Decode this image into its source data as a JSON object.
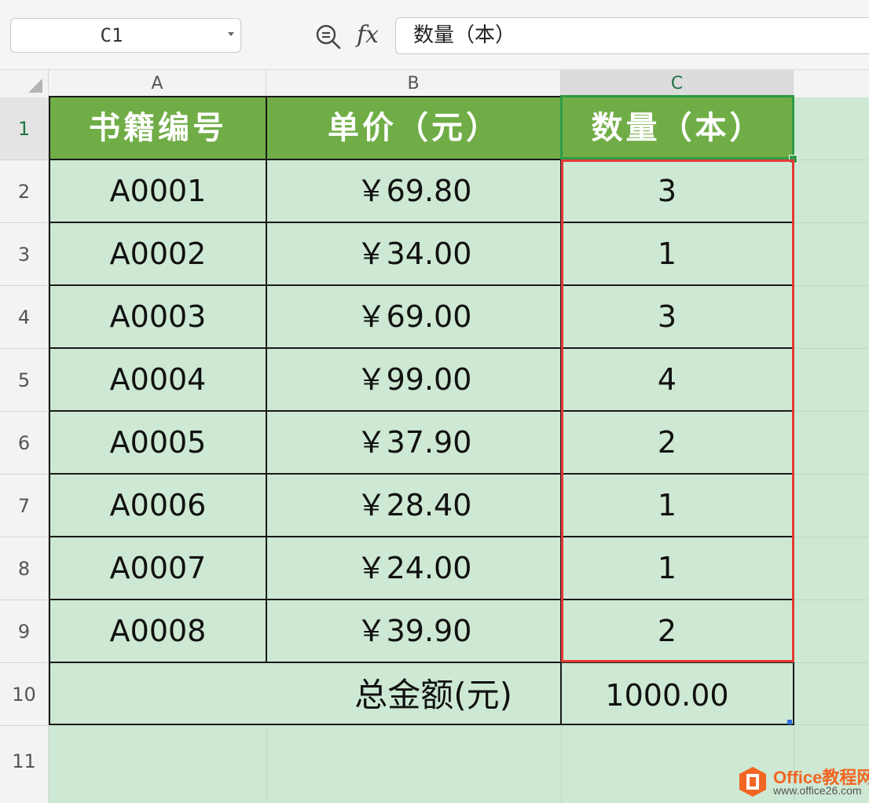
{
  "formula_bar": {
    "name_box": "C1",
    "formula": "数量（本）"
  },
  "columns": [
    "A",
    "B",
    "C"
  ],
  "rows": [
    "1",
    "2",
    "3",
    "4",
    "5",
    "6",
    "7",
    "8",
    "9",
    "10",
    "11"
  ],
  "table": {
    "headers": [
      "书籍编号",
      "单价（元）",
      "数量（本）"
    ],
    "records": [
      {
        "id": "A0001",
        "price": "￥69.80",
        "qty": "3"
      },
      {
        "id": "A0002",
        "price": "￥34.00",
        "qty": "1"
      },
      {
        "id": "A0003",
        "price": "￥69.00",
        "qty": "3"
      },
      {
        "id": "A0004",
        "price": "￥99.00",
        "qty": "4"
      },
      {
        "id": "A0005",
        "price": "￥37.90",
        "qty": "2"
      },
      {
        "id": "A0006",
        "price": "￥28.40",
        "qty": "1"
      },
      {
        "id": "A0007",
        "price": "￥24.00",
        "qty": "1"
      },
      {
        "id": "A0008",
        "price": "￥39.90",
        "qty": "2"
      }
    ],
    "total_label": "总金额(元)",
    "total_value": "1000.00"
  },
  "colors": {
    "header_fill": "#70ad47",
    "cell_fill": "#cde8d3",
    "selection": "#2e9a46",
    "highlight": "#e53935"
  },
  "watermark": {
    "title": "Office教程网",
    "url": "www.office26.com",
    "logo_icon": "office-logo-icon"
  }
}
